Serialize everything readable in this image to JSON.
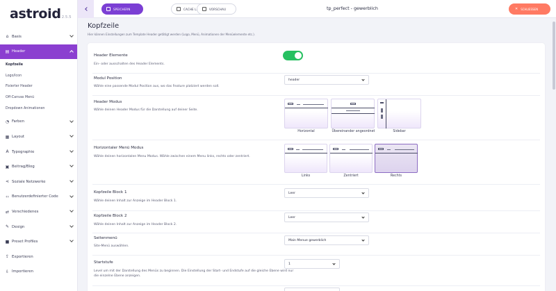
{
  "app": {
    "logo": "astroid",
    "version": "2.5.5"
  },
  "topbar": {
    "save_label": "SPEICHERN",
    "clear_label": "CACHE LEEREN",
    "preview_label": "VORSCHAU",
    "title": "tp_perfect - gewerblich",
    "close_label": "SCHLIESSEN"
  },
  "sidebar": {
    "items": [
      {
        "label": "Basis",
        "icon": "home-icon"
      },
      {
        "label": "Header",
        "icon": "header-icon"
      },
      {
        "label": "Farben",
        "icon": "palette-icon"
      },
      {
        "label": "Layout",
        "icon": "layout-icon"
      },
      {
        "label": "Typographie",
        "icon": "font-icon"
      },
      {
        "label": "Beitrag/Blog",
        "icon": "blog-icon"
      },
      {
        "label": "Soziale Netzwerke",
        "icon": "share-icon"
      },
      {
        "label": "Benutzerdefinierter Code",
        "icon": "code-icon"
      },
      {
        "label": "Verschiedenes",
        "icon": "misc-icon"
      },
      {
        "label": "Design",
        "icon": "brush-icon"
      },
      {
        "label": "Preset Profiles",
        "icon": "preset-icon"
      },
      {
        "label": "Exportieren",
        "icon": "export-icon"
      },
      {
        "label": "Importieren",
        "icon": "import-icon"
      }
    ],
    "subitems": [
      "Kopfzeile",
      "Logo/Icon",
      "Fixierter Header",
      "Off-Canvas Menü",
      "Dropdown Animationen"
    ]
  },
  "page": {
    "title": "Kopfzeile",
    "description": "Hier können Einstellungen zum Template Header getätigt werden (Logo, Menü, Animationen der Menüelemente etc.)."
  },
  "settings": {
    "header_elements": {
      "label": "Header Elemente",
      "desc": "Ein- oder ausschalten des Header Elements.",
      "enabled": true
    },
    "module_position": {
      "label": "Modul Position",
      "desc": "Wähle eine passende Modul Position aus, wo das Feature platziert werden soll.",
      "value": "header"
    },
    "header_mode": {
      "label": "Header Modus",
      "desc": "Wähle deinen Header Modus für die Darstellung auf deiner Seite.",
      "options": [
        "Horizontal",
        "Übereinander angeordnet",
        "Sidebar"
      ]
    },
    "horizontal_menu_mode": {
      "label": "Horizontaler Menü Modus",
      "desc": "Wähle deinen horizontalen Menu Modus. Wähle zwischen einem Menu links, rechts oder zentriert.",
      "options": [
        "Links",
        "Zentriert",
        "Rechts"
      ],
      "selected": "Rechts"
    },
    "block1": {
      "label": "Kopfzeile Block 1",
      "desc": "Wähle deinen Inhalt zur Anzeige im Header Block 1.",
      "value": "Leer"
    },
    "block2": {
      "label": "Kopfzeile Block 2",
      "desc": "Wähle deinen Inhalt zur Anzeige im Header Block 2.",
      "value": "Leer"
    },
    "site_menu": {
      "label": "Seitenmenü",
      "desc": "Site-Menü auswählen.",
      "value": "Main Menue gewerblich"
    },
    "start_level": {
      "label": "Startstufe",
      "desc": "Level um mit der Darstellung des Menüs zu beginnen. Die Einstellung der Start- und Endstufe auf die gleiche Ebene wird nur die einzelne Ebene anzeigen.",
      "value": "1"
    }
  },
  "colors": {
    "accent": "#8b3fd0",
    "toggle_on": "#27c061",
    "close": "#ff7a63"
  }
}
